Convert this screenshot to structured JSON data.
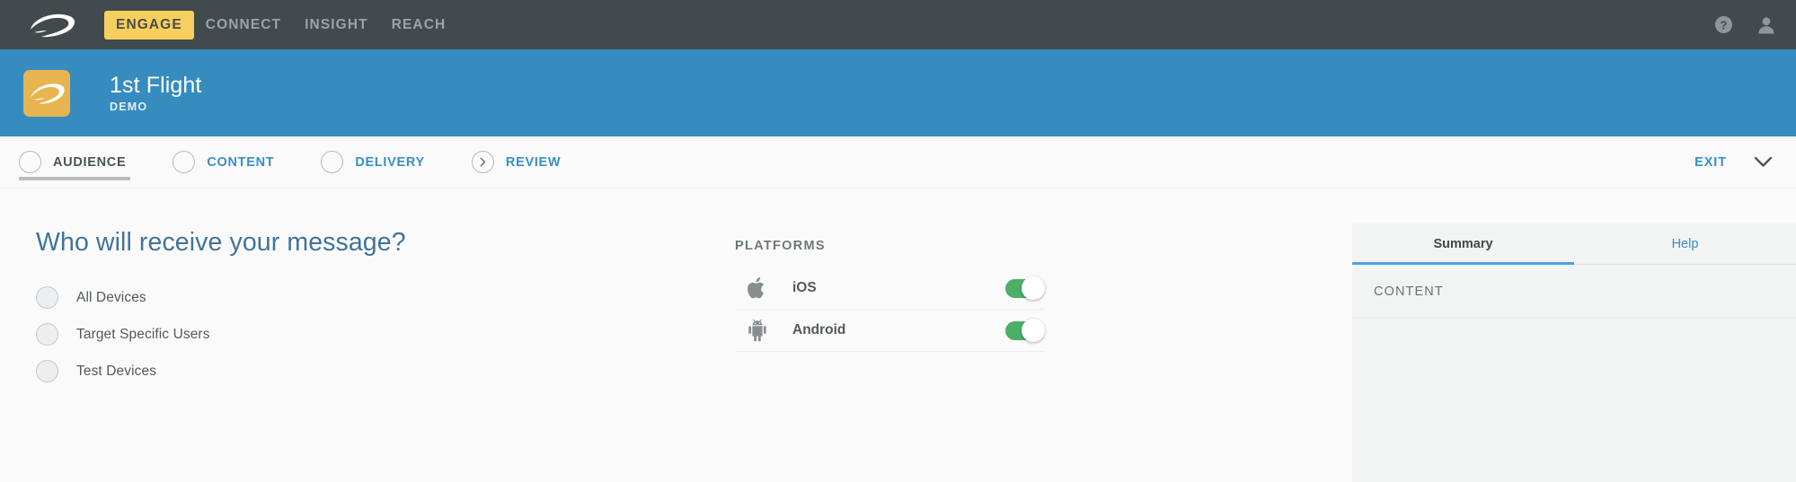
{
  "topbar": {
    "logo_icon": "swoosh-logo-icon",
    "nav": [
      {
        "label": "ENGAGE",
        "active": true
      },
      {
        "label": "CONNECT",
        "active": false
      },
      {
        "label": "INSIGHT",
        "active": false
      },
      {
        "label": "REACH",
        "active": false
      }
    ],
    "help_icon": "help-circle-icon",
    "account_icon": "user-account-icon"
  },
  "flight_header": {
    "app_icon": "swoosh-app-icon",
    "title": "1st Flight",
    "subtitle": "DEMO"
  },
  "steps": [
    {
      "label": "AUDIENCE",
      "active": true,
      "icon": "empty-circle-icon"
    },
    {
      "label": "CONTENT",
      "active": false,
      "icon": "empty-circle-icon"
    },
    {
      "label": "DELIVERY",
      "active": false,
      "icon": "empty-circle-icon"
    },
    {
      "label": "REVIEW",
      "active": false,
      "icon": "chevron-right-circle-icon"
    }
  ],
  "stepbar_actions": {
    "exit_label": "EXIT",
    "collapse_icon": "chevron-down-icon"
  },
  "audience": {
    "question": "Who will receive your message?",
    "options": [
      {
        "label": "All Devices",
        "selected": false
      },
      {
        "label": "Target Specific Users",
        "selected": false
      },
      {
        "label": "Test Devices",
        "selected": false
      }
    ]
  },
  "platforms": {
    "title": "PLATFORMS",
    "rows": [
      {
        "name": "iOS",
        "icon": "apple-icon",
        "enabled": true
      },
      {
        "name": "Android",
        "icon": "android-icon",
        "enabled": true
      }
    ]
  },
  "sidebar": {
    "tabs": [
      {
        "label": "Summary",
        "active": true
      },
      {
        "label": "Help",
        "active": false
      }
    ],
    "sections": [
      {
        "title": "CONTENT"
      }
    ]
  },
  "colors": {
    "topbar_bg": "#414b4e",
    "accent_yellow": "#f6cf5e",
    "header_blue": "#368cbf",
    "link_blue": "#3a8fc4",
    "toggle_green": "#4caf68",
    "heading_blue": "#41739a",
    "app_icon_gold": "#e8b44f"
  }
}
